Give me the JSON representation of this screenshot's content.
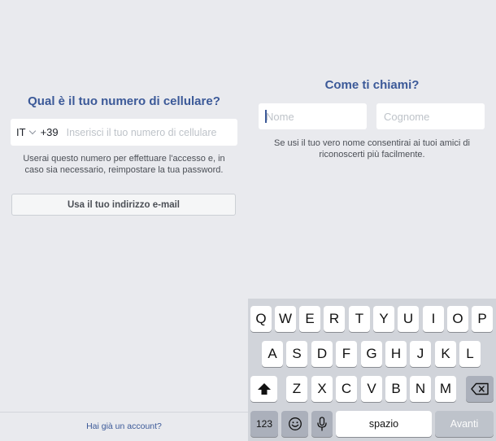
{
  "phone_screen": {
    "title": "Qual è il tuo numero di cellulare?",
    "country_code": "IT",
    "dial_prefix": "+39",
    "phone_placeholder": "Inserisci il tuo numero di cellulare",
    "info_line1": "Userai questo numero per effettuare l'accesso e, in",
    "info_line2": "caso sia necessario, reimpostare la tua password.",
    "email_button_label": "Usa il tuo indirizzo e-mail",
    "account_link": "Hai già un account?"
  },
  "name_screen": {
    "title": "Come ti chiami?",
    "first_name_placeholder": "Nome",
    "last_name_placeholder": "Cognome",
    "info_line1": "Se usi il tuo vero nome consentirai ai tuoi amici di",
    "info_line2": "riconoscerti più facilmente."
  },
  "keyboard": {
    "row1": [
      "Q",
      "W",
      "E",
      "R",
      "T",
      "Y",
      "U",
      "I",
      "O",
      "P"
    ],
    "row2": [
      "A",
      "S",
      "D",
      "F",
      "G",
      "H",
      "J",
      "K",
      "L"
    ],
    "row3": [
      "Z",
      "X",
      "C",
      "V",
      "B",
      "N",
      "M"
    ],
    "numbers_label": "123",
    "space_label": "spazio",
    "next_label": "Avanti",
    "shift_icon": "shift-icon",
    "delete_icon": "backspace-icon",
    "emoji_icon": "emoji-icon",
    "mic_icon": "microphone-icon"
  },
  "colors": {
    "brand_blue": "#3b5998",
    "background": "#e9eaee",
    "keyboard_bg": "#d1d4da"
  }
}
